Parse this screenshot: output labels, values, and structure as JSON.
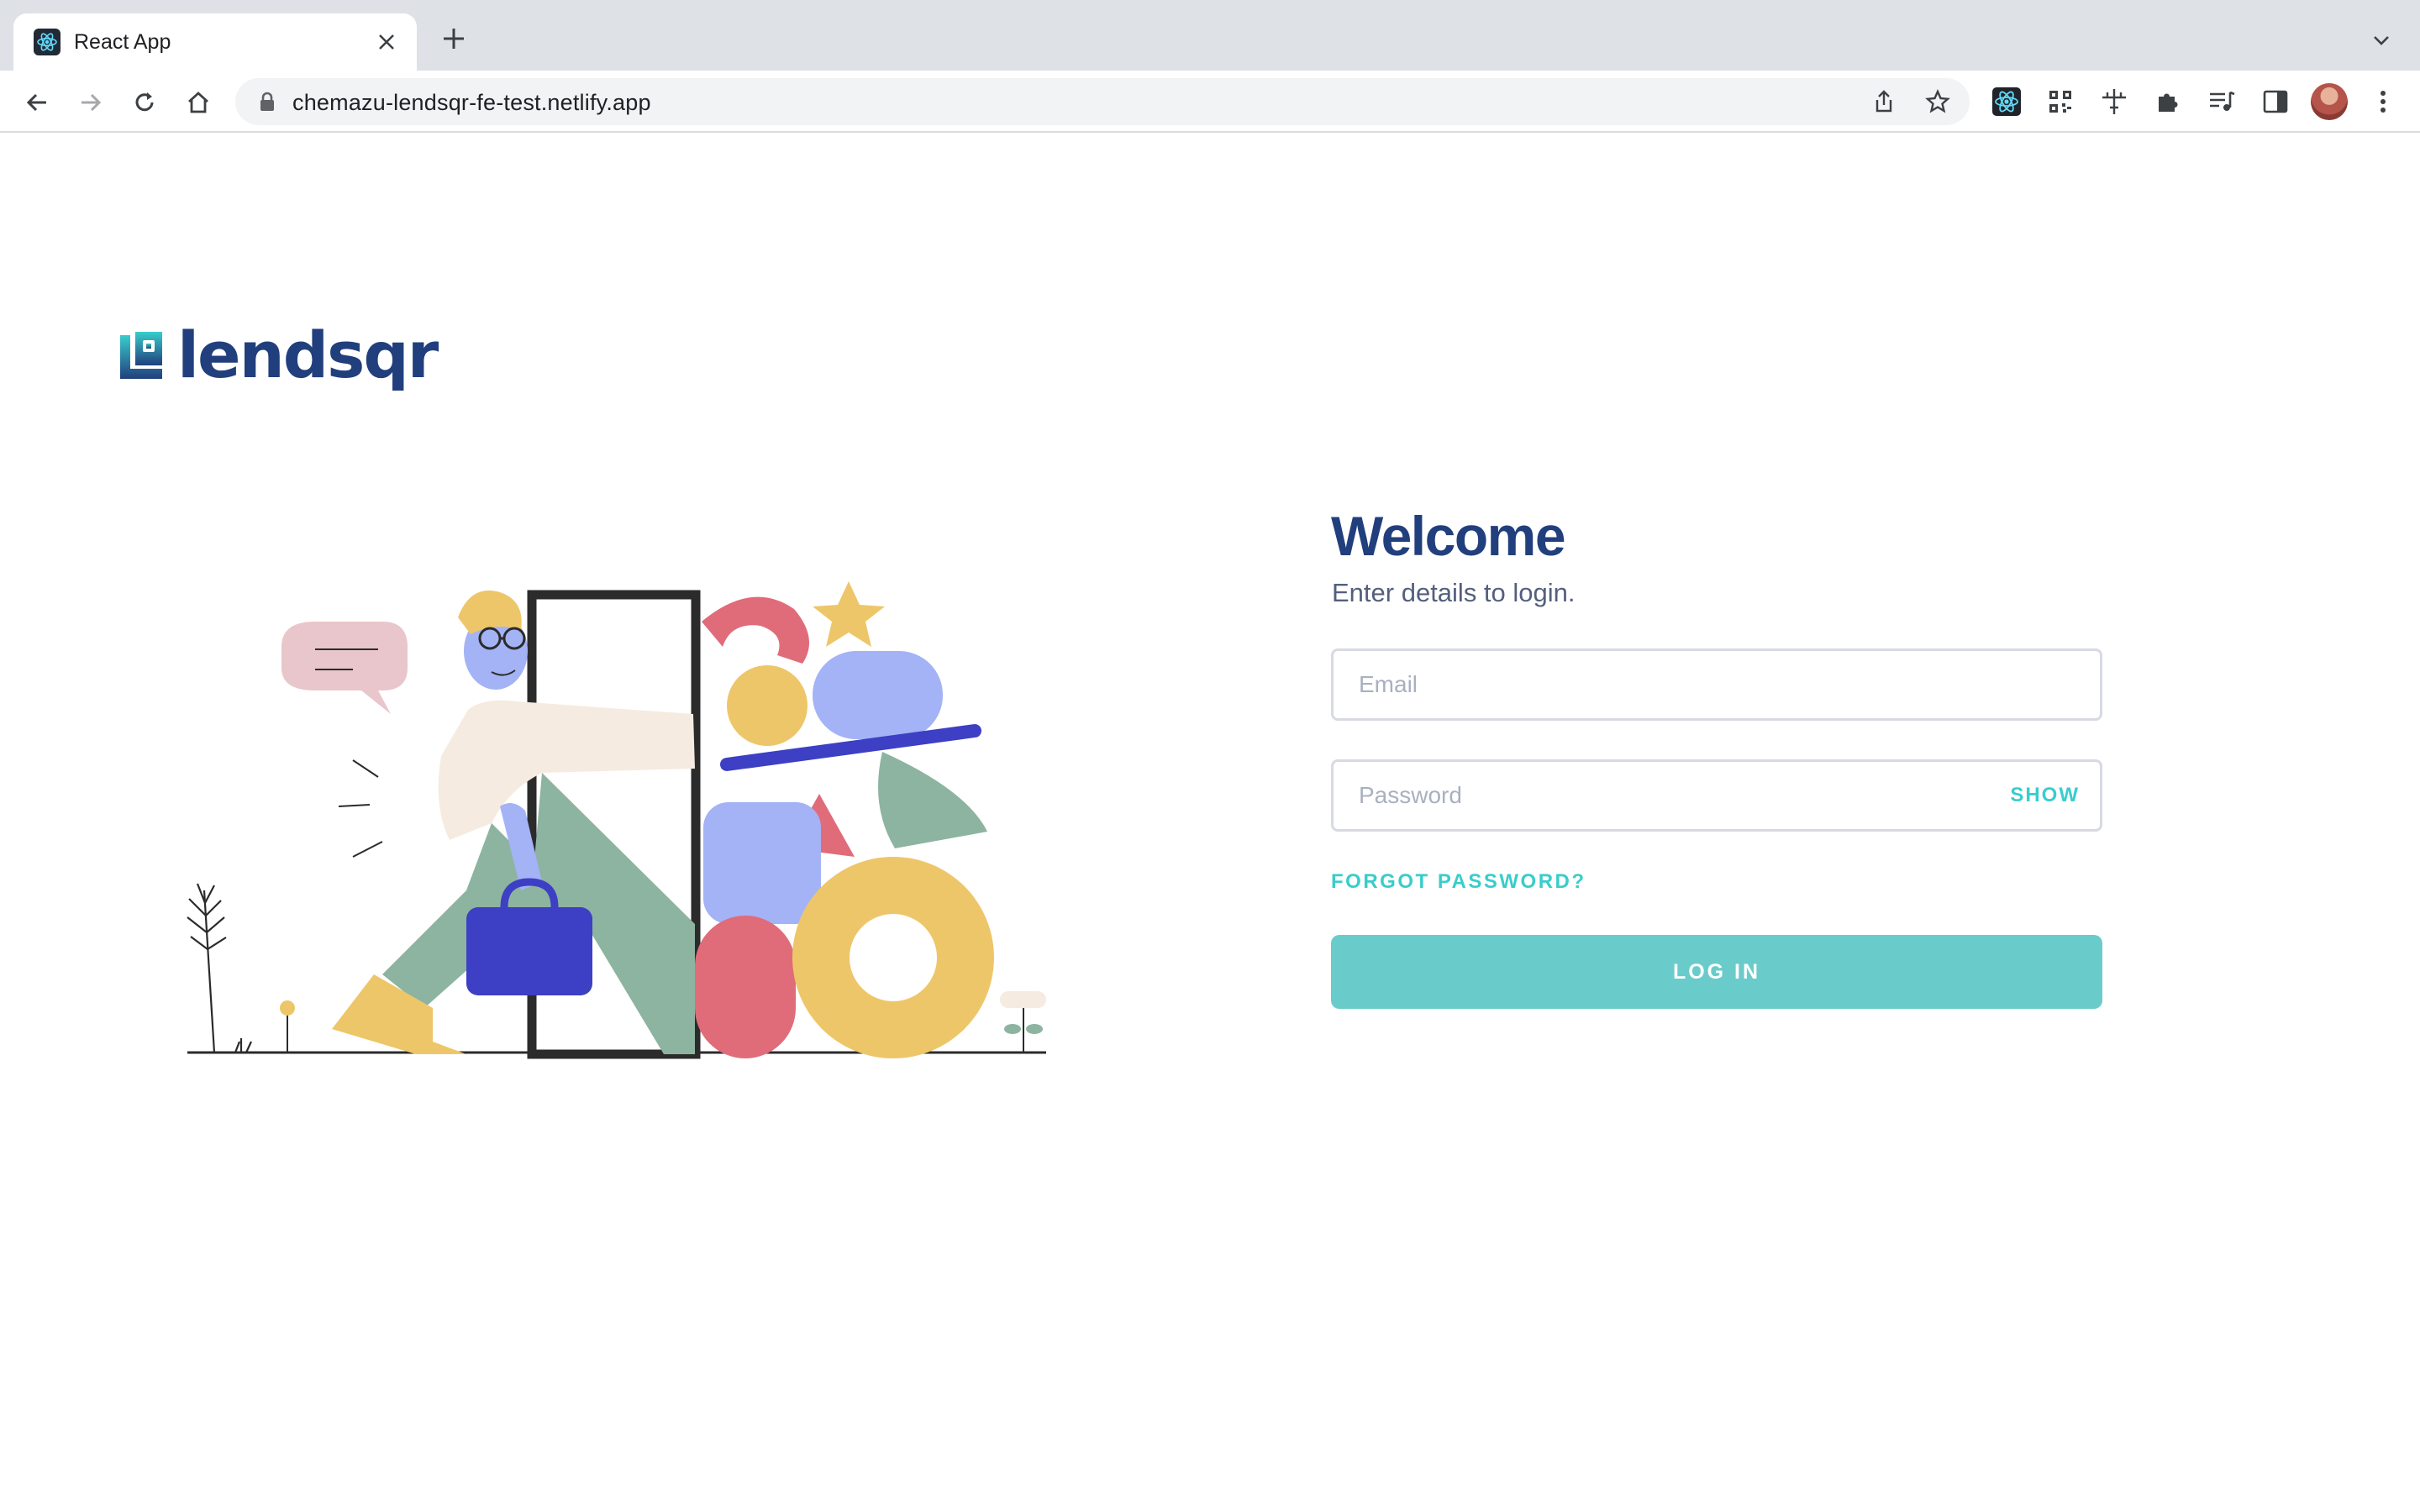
{
  "browser": {
    "tab": {
      "title": "React App",
      "favicon": "react-icon",
      "close_icon": "close-icon"
    },
    "new_tab_icon": "plus-icon",
    "tab_search_icon": "chevron-down-icon",
    "toolbar": {
      "back_icon": "arrow-left-icon",
      "forward_icon": "arrow-right-icon",
      "reload_icon": "reload-icon",
      "home_icon": "home-icon",
      "url": "chemazu-lendsqr-fe-test.netlify.app",
      "lock_icon": "lock-icon",
      "share_icon": "share-icon",
      "bookmark_icon": "star-icon",
      "extensions": [
        "react-devtools-icon",
        "qr-code-icon",
        "ruler-icon",
        "puzzle-icon",
        "media-control-icon",
        "side-panel-icon"
      ],
      "avatar": "profile-avatar",
      "menu_icon": "kebab-menu-icon"
    }
  },
  "page": {
    "logo": {
      "text": "lendsqr",
      "color": "#213f7d",
      "mark_colors": [
        "#39cdcc",
        "#213f7d"
      ]
    },
    "welcome": {
      "title": "Welcome",
      "subtitle": "Enter details to login."
    },
    "form": {
      "email_placeholder": "Email",
      "email_value": "",
      "password_placeholder": "Password",
      "password_value": "",
      "show_label": "SHOW",
      "forgot_label": "FORGOT PASSWORD?",
      "login_label": "LOG IN"
    },
    "colors": {
      "accent": "#39cdcc",
      "button": "#6acbcb",
      "heading": "#213f7d",
      "subtext": "#545f7d"
    }
  }
}
